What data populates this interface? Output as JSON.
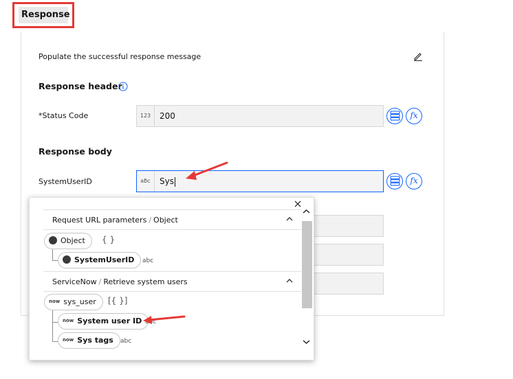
{
  "tab": {
    "label": "Response"
  },
  "panel": {
    "description": "Populate the successful response message",
    "header_section": "Response header",
    "body_section": "Response body",
    "status_code": {
      "label": "*Status Code",
      "type_badge": "123",
      "value": "200"
    },
    "system_user_id": {
      "label": "SystemUserID",
      "type_badge": "abc",
      "value": "Sys"
    }
  },
  "dropdown": {
    "sections": [
      {
        "title": "Request URL parameters",
        "subtitle": "Object",
        "items": [
          {
            "label": "Object",
            "suffix": "{ }"
          },
          {
            "label": "SystemUserID",
            "type": "abc"
          }
        ]
      },
      {
        "title": "ServiceNow",
        "subtitle": "Retrieve system users",
        "items": [
          {
            "prefix": "now",
            "label": "sys_user",
            "suffix": "[{ }]"
          },
          {
            "prefix": "now",
            "label": "System user ID",
            "type": "abc"
          },
          {
            "prefix": "now",
            "label": "Sys tags",
            "type": "abc"
          }
        ]
      }
    ]
  },
  "colors": {
    "accent": "#0f62fe",
    "highlight": "#e53935"
  },
  "icons": [
    "edit-icon",
    "info-icon",
    "mapping-icon",
    "function-icon",
    "close-icon",
    "chevron-up-icon",
    "chevron-down-icon",
    "arrow-icon"
  ]
}
